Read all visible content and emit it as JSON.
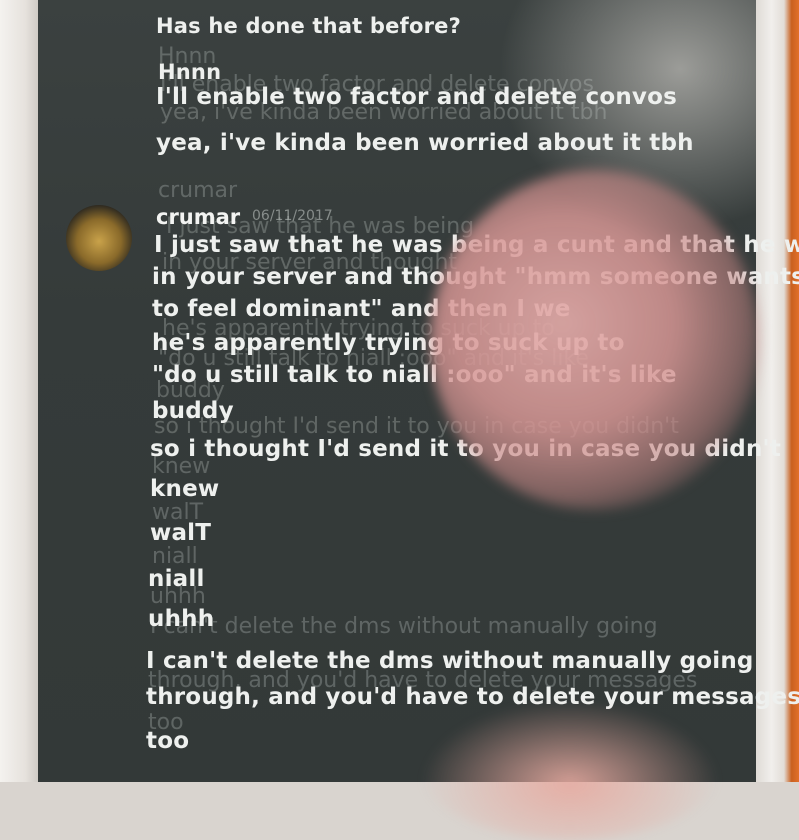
{
  "conversation": {
    "earlier_messages": [
      "Has he done that before?",
      "Hnnn",
      "I'll enable two factor and delete convos",
      "yea, i've kinda been worried about it tbh"
    ],
    "author": {
      "username": "crumar",
      "timestamp": "06/11/2017"
    },
    "messages": [
      "I just saw that he was being a cunt and that he was",
      "in your server and thought \"hmm someone wants",
      "to feel dominant\" and then I we",
      "he's apparently trying to suck up to",
      "\"do u still talk to niall :ooo\" and it's like",
      "buddy",
      "so i thought I'd send it to you in case you didn't",
      "knew",
      "walT",
      "niall",
      "uhhh",
      "I can't delete the dms without manually going",
      "through, and you'd have to delete your messages",
      "too"
    ],
    "ghost_text": [
      "Hnnn",
      "I'll enable two factor and delete convos",
      "yea, i've kinda been worried about it tbh",
      "crumar",
      "I just saw that he was being",
      "in your server and thought",
      "he's apparently trying to suck up to",
      "\"do u still talk to niall :ooo\" and it's like",
      "buddy",
      "so i thought I'd send it to you in case you didn't",
      "knew",
      "walT",
      "niall",
      "uhhh",
      "I can't delete the dms without manually going",
      "through, and you'd have to delete your messages",
      "too"
    ]
  },
  "colors": {
    "screen": "#363c3b",
    "text": "#eef0ee",
    "finger": "#d99a98",
    "frame_right_accent": "#e2702a"
  }
}
